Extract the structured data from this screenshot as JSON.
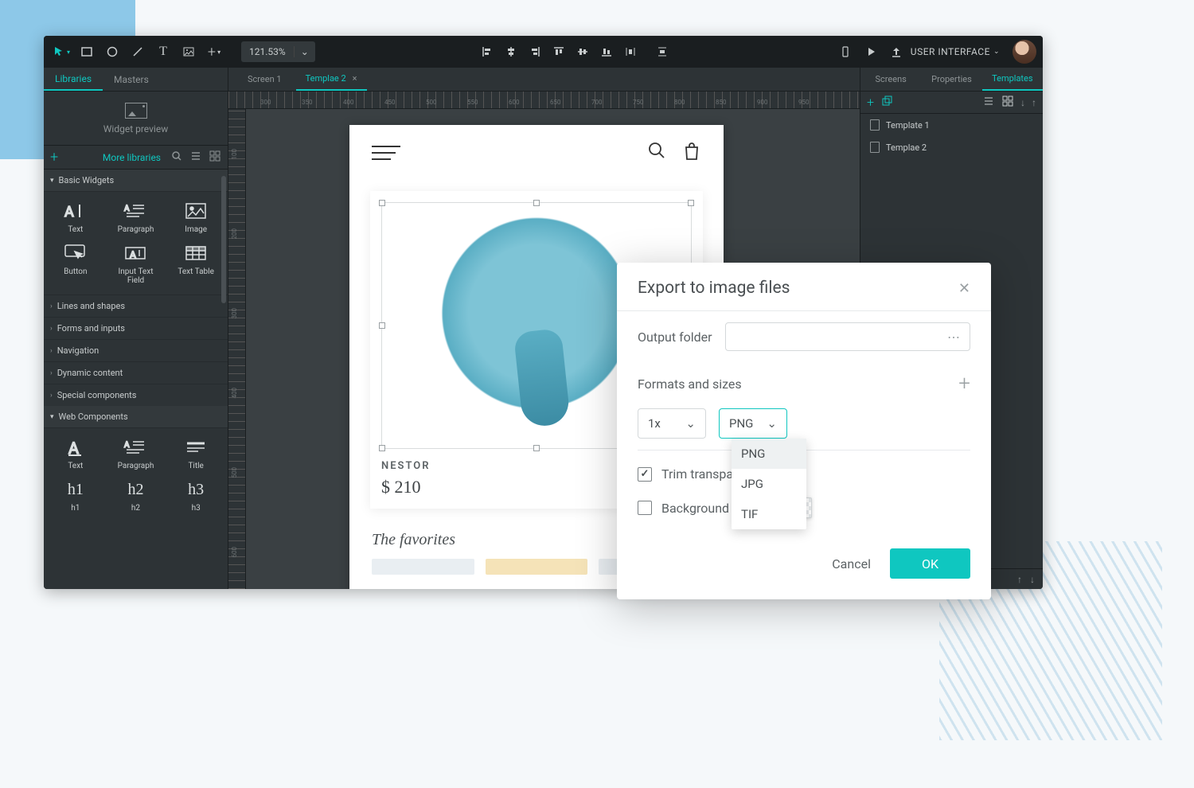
{
  "toolbar": {
    "zoom": "121.53%",
    "menu_label": "USER INTERFACE"
  },
  "left_panel": {
    "tabs": [
      "Libraries",
      "Masters"
    ],
    "active_tab": 0,
    "preview_label": "Widget preview",
    "more_libraries": "More libraries",
    "sections": {
      "basic_widgets": {
        "title": "Basic Widgets",
        "items": [
          "Text",
          "Paragraph",
          "Image",
          "Button",
          "Input Text Field",
          "Text Table"
        ]
      },
      "collapsed": [
        "Lines and shapes",
        "Forms and inputs",
        "Navigation",
        "Dynamic content",
        "Special components"
      ],
      "web_components": {
        "title": "Web Components",
        "row1": [
          "Text",
          "Paragraph",
          "Title"
        ],
        "row2": [
          "h1",
          "h2",
          "h3"
        ],
        "row2_labels": [
          "h1",
          "h2",
          "h3"
        ]
      }
    }
  },
  "canvas": {
    "tabs": [
      {
        "label": "Screen 1",
        "closable": false
      },
      {
        "label": "Templae 2",
        "closable": true
      }
    ],
    "active_tab": 1,
    "ruler_marks_h": [
      "300",
      "350",
      "400",
      "450",
      "500",
      "550",
      "600",
      "650",
      "700",
      "750",
      "800",
      "850",
      "900",
      "950",
      "1000",
      "1050"
    ],
    "ruler_marks_v": [
      "100",
      "200",
      "300",
      "400",
      "500",
      "600"
    ],
    "product": {
      "name": "NESTOR",
      "price": "$ 210"
    },
    "favorites_title": "The favorites"
  },
  "right_panel": {
    "tabs": [
      "Screens",
      "Properties",
      "Templates"
    ],
    "active_tab": 2,
    "templates": [
      "Template 1",
      "Templae 2"
    ]
  },
  "dialog": {
    "title": "Export to image files",
    "output_folder_label": "Output folder",
    "output_folder_value": "",
    "section_title": "Formats and sizes",
    "size_value": "1x",
    "format_value": "PNG",
    "format_options": [
      "PNG",
      "JPG",
      "TIF"
    ],
    "trim_label": "Trim transparent pixels",
    "trim_checked": true,
    "bg_label": "Background color",
    "bg_checked": false,
    "cancel": "Cancel",
    "ok": "OK"
  }
}
